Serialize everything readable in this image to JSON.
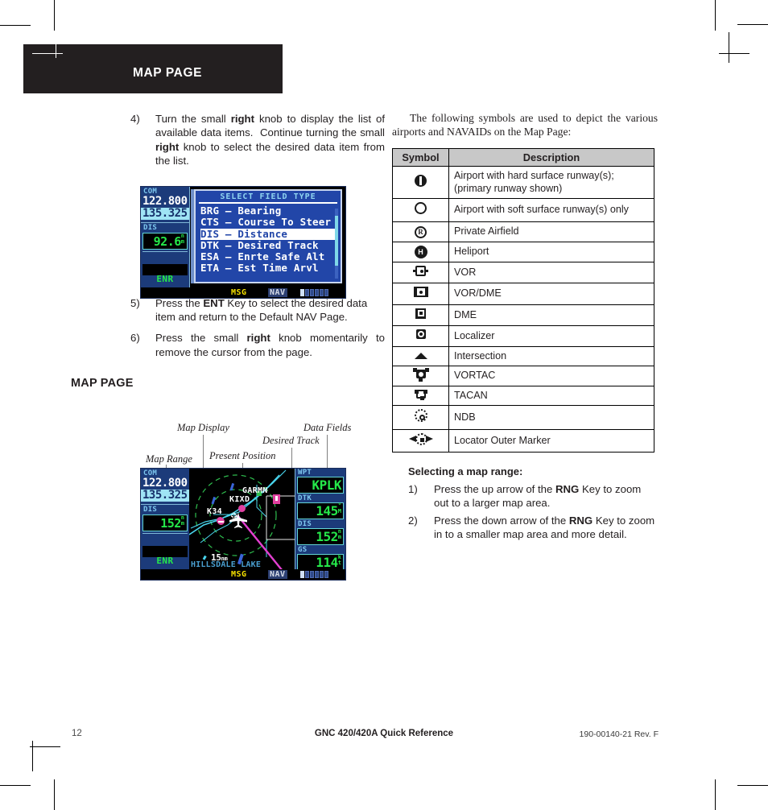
{
  "header": {
    "title": "MAP PAGE"
  },
  "left_column": {
    "steps": [
      {
        "num": "4)",
        "html": "Turn the small <b>right</b> knob to display the list of available data items.&nbsp; Continue turning the small <b>right</b> knob to select the desired data item from the list."
      },
      {
        "num": "5)",
        "html": "Press the <b>ENT</b> Key to select the desired data item and return to the Default NAV Page."
      },
      {
        "num": "6)",
        "html": "Press the small <b>right</b> knob momentarily to remove the cursor from the page."
      }
    ],
    "section_heading": "MAP PAGE"
  },
  "screen_select_field": {
    "com_label": "COM",
    "com_active": "122.800",
    "com_standby": "135.325",
    "dis_label": "DIS",
    "dis_value": "92.6",
    "dis_unit_top": "n",
    "dis_unit_bot": "m",
    "mode": "ENR",
    "panel_title": "SELECT FIELD TYPE",
    "options": [
      {
        "code": "BRG",
        "name": "Bearing",
        "selected": false
      },
      {
        "code": "CTS",
        "name": "Course To Steer",
        "selected": false
      },
      {
        "code": "DIS",
        "name": "Distance",
        "selected": true
      },
      {
        "code": "DTK",
        "name": "Desired Track",
        "selected": false
      },
      {
        "code": "ESA",
        "name": "Enrte Safe Alt",
        "selected": false
      },
      {
        "code": "ETA",
        "name": "Est Time Arvl",
        "selected": false
      }
    ],
    "status_hsg": "MSG",
    "status_nav": "NAV"
  },
  "map_callouts": [
    {
      "label": "Map Display"
    },
    {
      "label": "Data Fields"
    },
    {
      "label": "Desired Track"
    },
    {
      "label": "Map Range"
    },
    {
      "label": "Present Position"
    }
  ],
  "screen_map": {
    "com_label": "COM",
    "com_active": "122.800",
    "com_standby": "135.325",
    "dis_label": "DIS",
    "dis_value": "152",
    "dis_unit_top": "n",
    "dis_unit_bot": "m",
    "mode": "ENR",
    "range": "15",
    "range_unit": "nm",
    "lake_label": "HILLSDALE LAKE",
    "map_labels": {
      "waypoint_1": "KIXD",
      "waypoint_2": "K34",
      "waypoint_3": "GARMN"
    },
    "data_fields": [
      {
        "label": "WPT",
        "value": "KPLK",
        "unit_top": "",
        "unit_bot": ""
      },
      {
        "label": "DTK",
        "value": "145",
        "unit_top": "°",
        "unit_bot": "M"
      },
      {
        "label": "DIS",
        "value": "152",
        "unit_top": "n",
        "unit_bot": "m"
      },
      {
        "label": "GS",
        "value": "114",
        "unit_top": "k",
        "unit_bot": "t"
      }
    ],
    "status_hsg": "MSG",
    "status_nav": "NAV"
  },
  "right_column": {
    "intro": "The following symbols are used to depict the various airports and NAVAIDs on the Map Page:",
    "table": {
      "headers": [
        "Symbol",
        "Description"
      ],
      "rows": [
        {
          "icon": "airport-hard-surface-icon",
          "description": "Airport with hard surface runway(s); (primary runway shown)"
        },
        {
          "icon": "airport-soft-surface-icon",
          "description": "Airport with soft surface runway(s) only"
        },
        {
          "icon": "private-airfield-icon",
          "description": "Private Airfield"
        },
        {
          "icon": "heliport-icon",
          "description": "Heliport"
        },
        {
          "icon": "vor-icon",
          "description": "VOR"
        },
        {
          "icon": "vor-dme-icon",
          "description": "VOR/DME"
        },
        {
          "icon": "dme-icon",
          "description": "DME"
        },
        {
          "icon": "localizer-icon",
          "description": "Localizer"
        },
        {
          "icon": "intersection-icon",
          "description": "Intersection"
        },
        {
          "icon": "vortac-icon",
          "description": "VORTAC"
        },
        {
          "icon": "tacan-icon",
          "description": "TACAN"
        },
        {
          "icon": "ndb-icon",
          "description": "NDB"
        },
        {
          "icon": "locator-outer-marker-icon",
          "description": "Locator Outer Marker"
        }
      ]
    },
    "sub_heading": "Selecting a map range:",
    "steps": [
      {
        "num": "1)",
        "html": "Press the up arrow of the <b>RNG</b> Key to zoom out to a larger map area."
      },
      {
        "num": "2)",
        "html": "Press the down arrow of the <b>RNG</b> Key to zoom in to a smaller map area and more detail."
      }
    ]
  },
  "footer": {
    "page_number": "12",
    "center": "GNC 420/420A Quick Reference",
    "right": "190-00140-21  Rev. F"
  },
  "colors": {
    "banner": "#231f20",
    "table_header": "#c8c8c8",
    "gps_blue": "#1c3b7a",
    "gps_green": "#25e84a",
    "gps_cyan": "#7ec8f0"
  }
}
